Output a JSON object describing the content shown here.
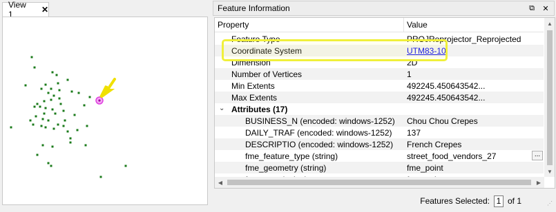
{
  "view": {
    "tab_label": "View 1",
    "close_glyph": "✕",
    "points_color": "#1a7a1a",
    "selected_color": "#e040e0",
    "arrow_color": "#f0e000"
  },
  "info_panel": {
    "title": "Feature Information",
    "float_glyph": "⧉",
    "close_glyph": "✕",
    "columns": {
      "property": "Property",
      "value": "Value"
    },
    "rows": [
      {
        "property": "Feature Type",
        "value": "PROJReprojector_Reprojected",
        "level": 1,
        "link": false,
        "bold": false
      },
      {
        "property": "Coordinate System",
        "value": "UTM83-10",
        "level": 1,
        "link": true,
        "bold": false
      },
      {
        "property": "Dimension",
        "value": "2D",
        "level": 1,
        "link": false,
        "bold": false
      },
      {
        "property": "Number of Vertices",
        "value": "1",
        "level": 1,
        "link": false,
        "bold": false
      },
      {
        "property": "Min Extents",
        "value": "492245.450643542...",
        "level": 1,
        "link": false,
        "bold": false
      },
      {
        "property": "Max Extents",
        "value": "492245.450643542...",
        "level": 1,
        "link": false,
        "bold": false
      },
      {
        "property": "Attributes (17)",
        "value": "",
        "level": 0,
        "link": false,
        "bold": true,
        "expander": "⌄"
      },
      {
        "property": "BUSINESS_N (encoded: windows-1252)",
        "value": "Chou Chou Crepes",
        "level": 2,
        "link": false,
        "bold": false
      },
      {
        "property": "DAILY_TRAF (encoded: windows-1252)",
        "value": "137",
        "level": 2,
        "link": false,
        "bold": false
      },
      {
        "property": "DESCRIPTIO (encoded: windows-1252)",
        "value": "French Crepes",
        "level": 2,
        "link": false,
        "bold": false
      },
      {
        "property": "fme_feature_type (string)",
        "value": "street_food_vendors_27",
        "level": 2,
        "link": false,
        "bold": false,
        "ellipsis": "..."
      },
      {
        "property": "fme_geometry (string)",
        "value": "fme_point",
        "level": 2,
        "link": false,
        "bold": false
      },
      {
        "property": "fme_type (string)",
        "value": "fme_point",
        "level": 2,
        "link": false,
        "bold": false
      }
    ],
    "highlight_color": "#f0f03a"
  },
  "footer": {
    "features_selected_label": "Features Selected:",
    "current_page": "1",
    "of_label": "of 1"
  }
}
